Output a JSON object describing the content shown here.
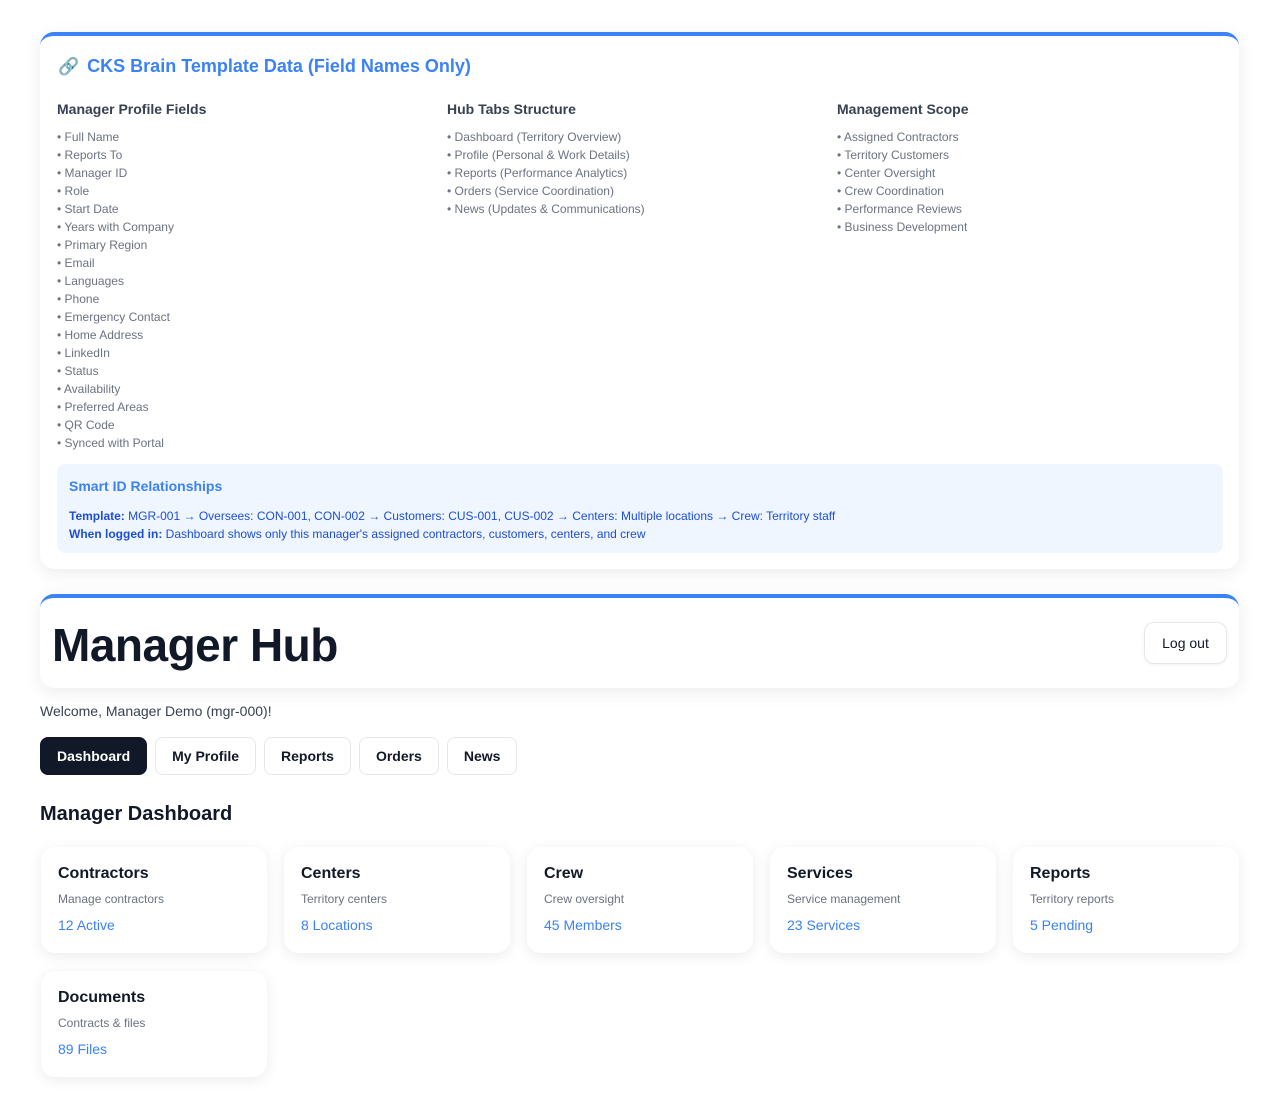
{
  "template": {
    "icon": "link-icon",
    "title": "CKS Brain Template Data (Field Names Only)",
    "columns": [
      {
        "heading": "Manager Profile Fields",
        "items": [
          "Full Name",
          "Reports To",
          "Manager ID",
          "Role",
          "Start Date",
          "Years with Company",
          "Primary Region",
          "Email",
          "Languages",
          "Phone",
          "Emergency Contact",
          "Home Address",
          "LinkedIn",
          "Status",
          "Availability",
          "Preferred Areas",
          "QR Code",
          "Synced with Portal"
        ]
      },
      {
        "heading": "Hub Tabs Structure",
        "items": [
          "Dashboard (Territory Overview)",
          "Profile (Personal & Work Details)",
          "Reports (Performance Analytics)",
          "Orders (Service Coordination)",
          "News (Updates & Communications)"
        ]
      },
      {
        "heading": "Management Scope",
        "items": [
          "Assigned Contractors",
          "Territory Customers",
          "Center Oversight",
          "Crew Coordination",
          "Performance Reviews",
          "Business Development"
        ]
      }
    ],
    "smart": {
      "title": "Smart ID Relationships",
      "template_label": "Template:",
      "template_text": " MGR-001 → Oversees: CON-001, CON-002 → Customers: CUS-001, CUS-002 → Centers: Multiple locations → Crew: Territory staff",
      "logged_label": "When logged in:",
      "logged_text": " Dashboard shows only this manager's assigned contractors, customers, centers, and crew"
    }
  },
  "hub": {
    "title": "Manager Hub",
    "logout_label": "Log out",
    "welcome": "Welcome, Manager Demo (mgr-000)!"
  },
  "tabs": [
    {
      "label": "Dashboard",
      "active": true
    },
    {
      "label": "My Profile",
      "active": false
    },
    {
      "label": "Reports",
      "active": false
    },
    {
      "label": "Orders",
      "active": false
    },
    {
      "label": "News",
      "active": false
    }
  ],
  "dashboard": {
    "title": "Manager Dashboard",
    "tiles": [
      {
        "title": "Contractors",
        "subtitle": "Manage contractors",
        "value": "12 Active"
      },
      {
        "title": "Centers",
        "subtitle": "Territory centers",
        "value": "8 Locations"
      },
      {
        "title": "Crew",
        "subtitle": "Crew oversight",
        "value": "45 Members"
      },
      {
        "title": "Services",
        "subtitle": "Service management",
        "value": "23 Services"
      },
      {
        "title": "Reports",
        "subtitle": "Territory reports",
        "value": "5 Pending"
      },
      {
        "title": "Documents",
        "subtitle": "Contracts & files",
        "value": "89 Files"
      }
    ]
  },
  "colors": {
    "accent": "#3b82f6",
    "dark": "#111827",
    "smart_bg": "#eff6ff"
  }
}
